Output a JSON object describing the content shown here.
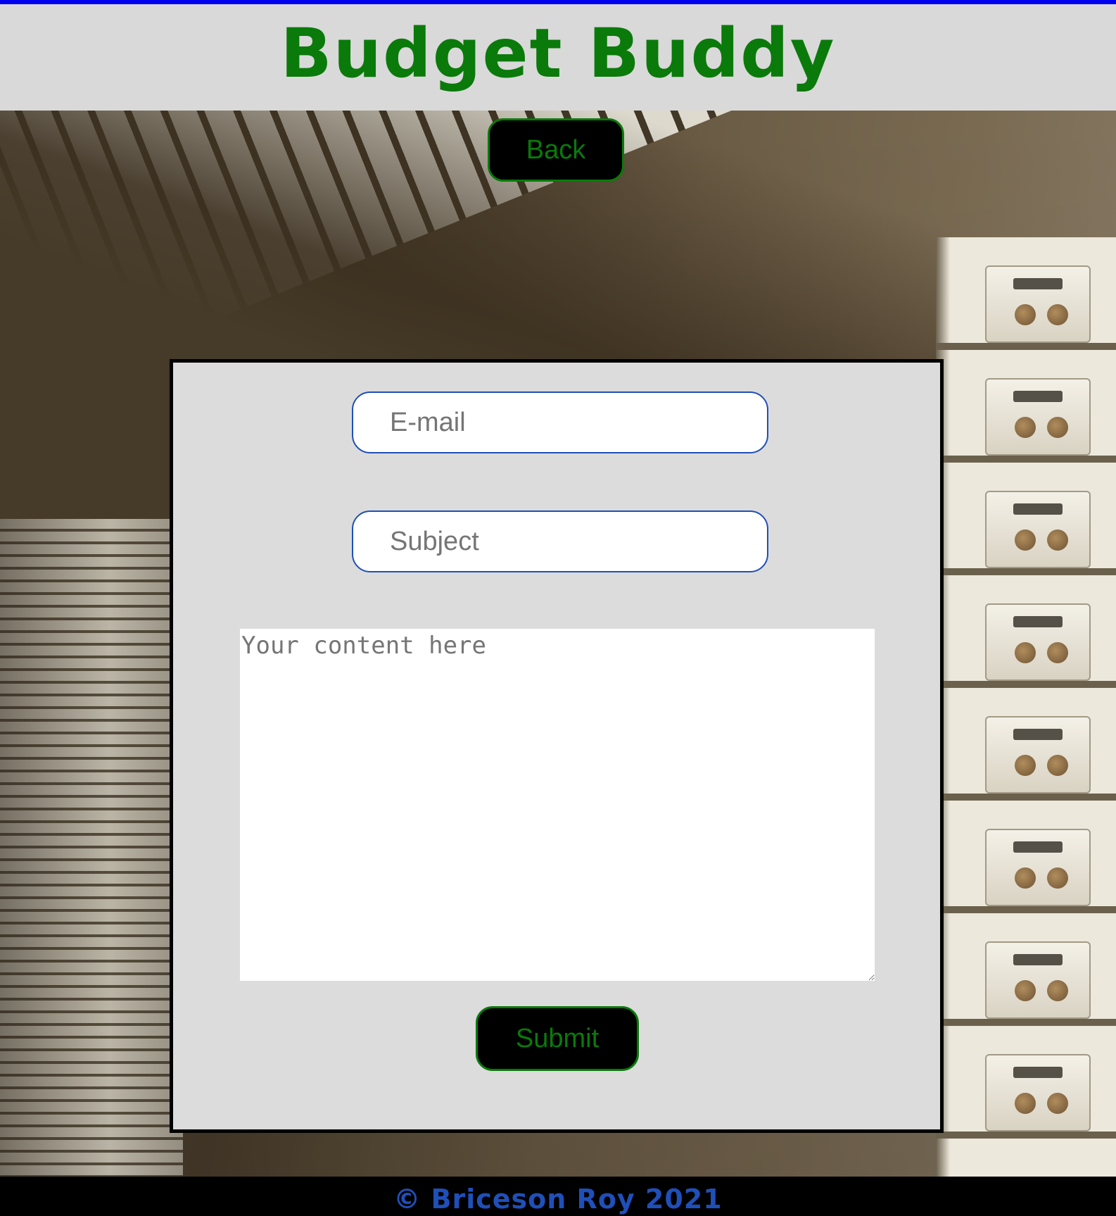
{
  "header": {
    "title": "Budget Buddy"
  },
  "nav": {
    "back_label": "Back"
  },
  "form": {
    "email_placeholder": "E-mail",
    "subject_placeholder": "Subject",
    "message_placeholder": "Your content here",
    "submit_label": "Submit"
  },
  "footer": {
    "copyright": "© Briceson Roy 2021"
  },
  "colors": {
    "accent_green": "#0a7a0a",
    "header_bg": "#d9d9d9",
    "panel_bg": "#dcdcdc",
    "input_border_blue": "#1f4fb8",
    "top_rule_blue": "#0000ee",
    "footer_bg": "#000000"
  },
  "background": {
    "description_icon": "bank-vault-deposit-boxes-photo"
  }
}
